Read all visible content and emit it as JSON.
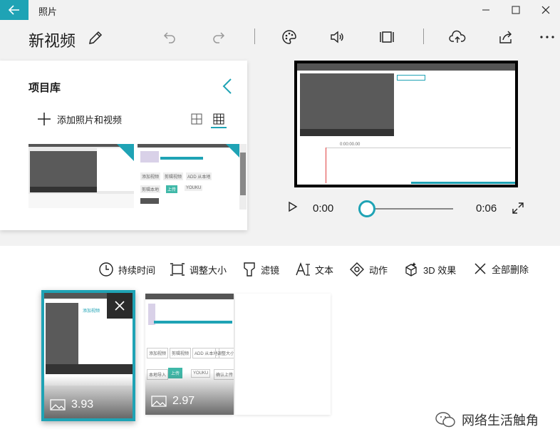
{
  "window": {
    "app_title": "照片"
  },
  "header": {
    "project_title": "新视频"
  },
  "library": {
    "title": "项目库",
    "add_label": "添加照片和视频"
  },
  "player": {
    "current_time": "0:00",
    "total_time": "0:06",
    "progress": 0.0
  },
  "storyboard": {
    "tools": [
      {
        "label": "持续时间",
        "icon": "clock-icon"
      },
      {
        "label": "调整大小",
        "icon": "resize-icon"
      },
      {
        "label": "滤镜",
        "icon": "filter-icon"
      },
      {
        "label": "文本",
        "icon": "text-icon"
      },
      {
        "label": "动作",
        "icon": "motion-icon"
      },
      {
        "label": "3D 效果",
        "icon": "3d-effects-icon"
      },
      {
        "label": "全部删除",
        "icon": "close-icon"
      }
    ],
    "cards": [
      {
        "duration": "3.93",
        "selected": true
      },
      {
        "duration": "2.97",
        "selected": false
      }
    ]
  },
  "thumbnail_text": {
    "t1": "添加视频",
    "t2": "剪辑视频",
    "t3": "ADD 从本地",
    "t4": "YOUKU",
    "t5": "剪辑本地",
    "t6": "本地导入",
    "t7": "调整大小",
    "t8": "确认上传",
    "t9": "上传",
    "t10": "0:00:00.00"
  },
  "watermark": {
    "text": "网络生活触角"
  },
  "colors": {
    "accent": "#1fa3b5"
  }
}
